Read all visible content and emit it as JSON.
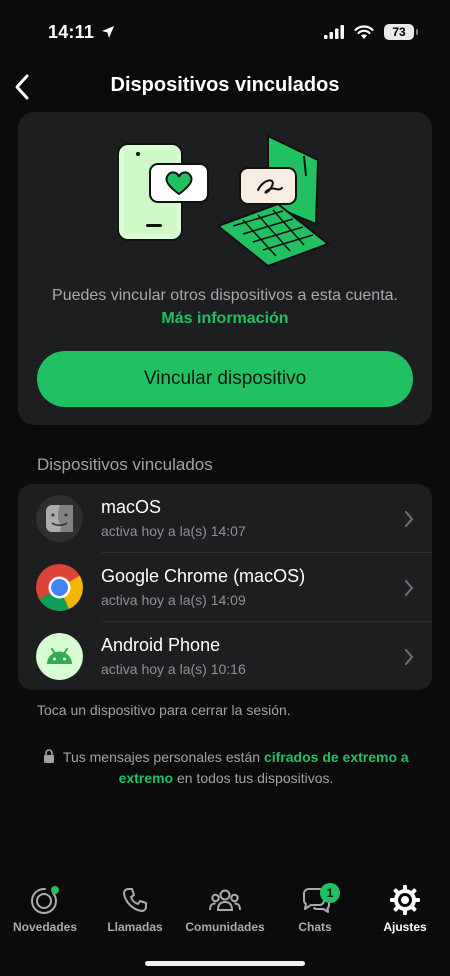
{
  "status_bar": {
    "time": "14:11",
    "battery": "73"
  },
  "header": {
    "title": "Dispositivos vinculados"
  },
  "hero": {
    "text": "Puedes vincular otros dispositivos a esta cuenta.",
    "link": "Más información",
    "button": "Vincular dispositivo"
  },
  "section": {
    "title": "Dispositivos vinculados"
  },
  "devices": [
    {
      "name": "macOS",
      "status": "activa hoy a la(s) 14:07",
      "icon": "finder-icon"
    },
    {
      "name": "Google Chrome (macOS)",
      "status": "activa hoy a la(s) 14:09",
      "icon": "chrome-icon"
    },
    {
      "name": "Android Phone",
      "status": "activa hoy a la(s) 10:16",
      "icon": "android-icon"
    }
  ],
  "hint": "Toca un dispositivo para cerrar la sesión.",
  "encryption": {
    "before": "Tus mensajes personales están",
    "link": "cifrados de extremo a extremo",
    "after": "en todos tus dispositivos."
  },
  "tabs": [
    {
      "label": "Novedades",
      "icon": "status-icon"
    },
    {
      "label": "Llamadas",
      "icon": "phone-icon"
    },
    {
      "label": "Comunidades",
      "icon": "communities-icon"
    },
    {
      "label": "Chats",
      "icon": "chats-icon",
      "badge": "1"
    },
    {
      "label": "Ajustes",
      "icon": "settings-icon",
      "active": true
    }
  ],
  "colors": {
    "accent": "#21c063",
    "background": "#0b0b0b",
    "card": "#1d1e20"
  }
}
